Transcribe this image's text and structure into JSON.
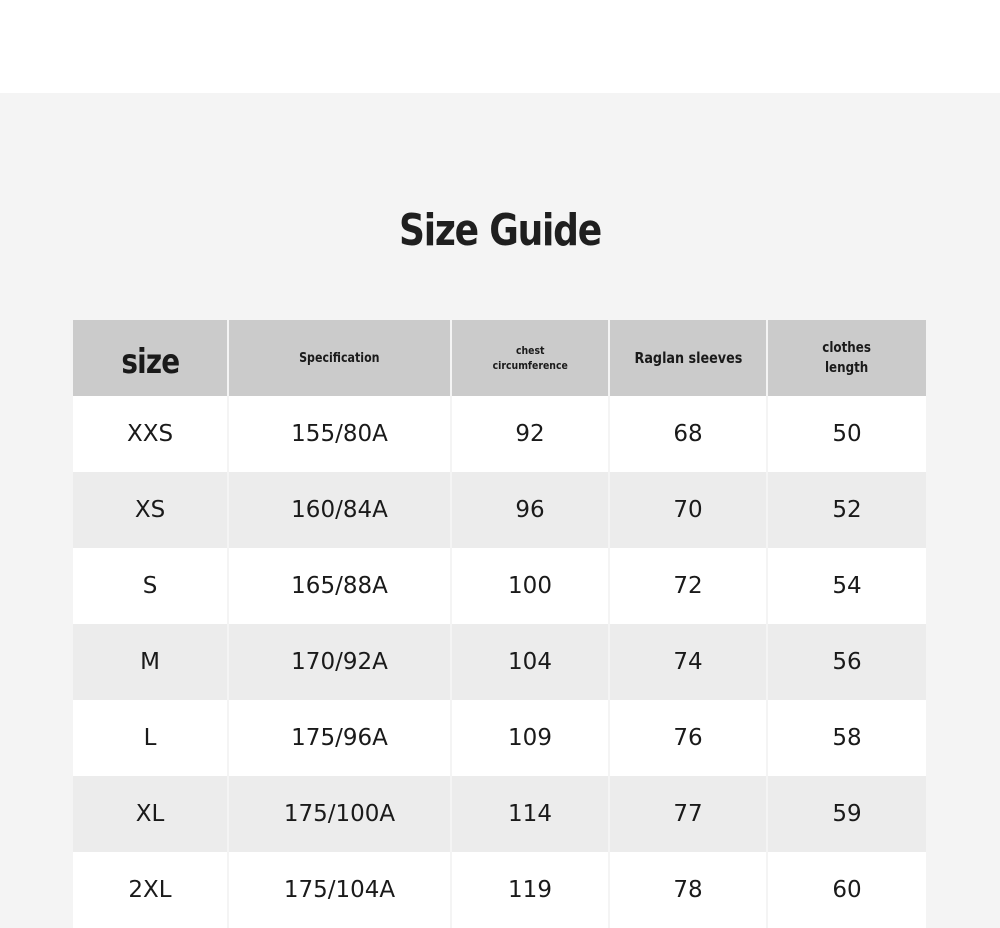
{
  "page": {
    "title": "Size Guide"
  },
  "table": {
    "headers": {
      "size": "size",
      "specification": "Specification",
      "chest": "chest\ncircumference",
      "raglan": "Raglan sleeves",
      "length": "clothes\nlength"
    },
    "rows": [
      {
        "size": "XXS",
        "spec": "155/80A",
        "chest": "92",
        "raglan": "68",
        "length": "50"
      },
      {
        "size": "XS",
        "spec": "160/84A",
        "chest": "96",
        "raglan": "70",
        "length": "52"
      },
      {
        "size": "S",
        "spec": "165/88A",
        "chest": "100",
        "raglan": "72",
        "length": "54"
      },
      {
        "size": "M",
        "spec": "170/92A",
        "chest": "104",
        "raglan": "74",
        "length": "56"
      },
      {
        "size": "L",
        "spec": "175/96A",
        "chest": "109",
        "raglan": "76",
        "length": "58"
      },
      {
        "size": "XL",
        "spec": "175/100A",
        "chest": "114",
        "raglan": "77",
        "length": "59"
      },
      {
        "size": "2XL",
        "spec": "175/104A",
        "chest": "119",
        "raglan": "78",
        "length": "60"
      }
    ]
  },
  "colors": {
    "background": "#f4f4f4",
    "header_row": "#cbcbcb",
    "row_light": "#ffffff",
    "row_shaded": "#ececec",
    "text": "#1a1a1a"
  }
}
